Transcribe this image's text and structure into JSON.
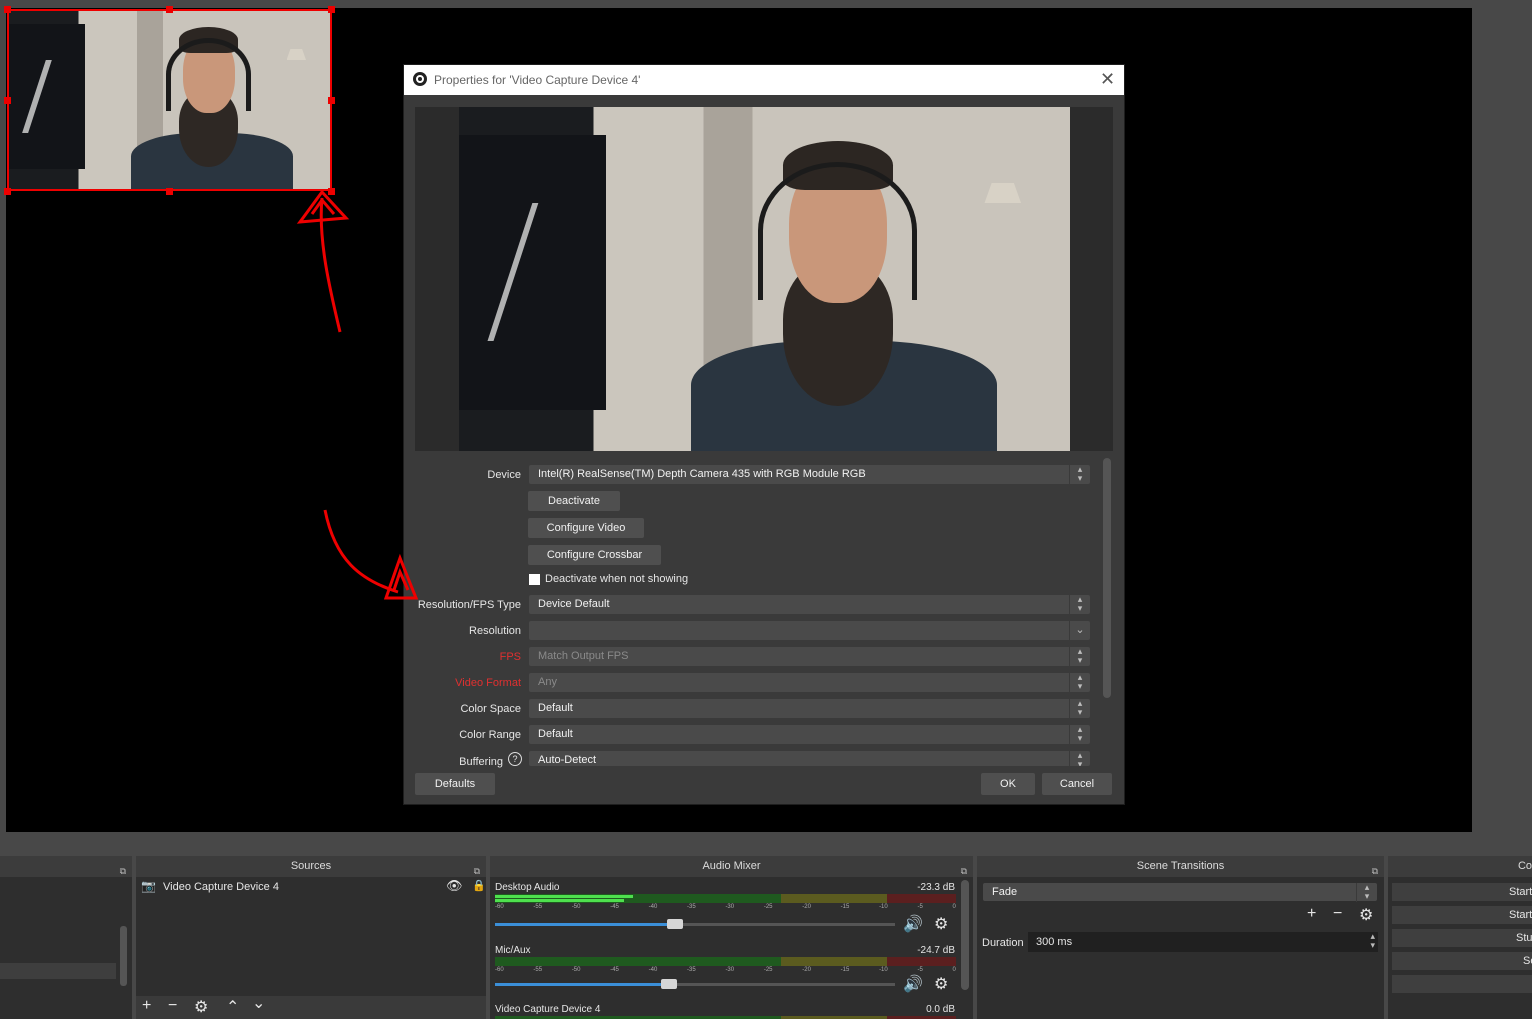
{
  "dialog": {
    "title": "Properties for 'Video Capture Device 4'",
    "close": "✕",
    "properties": {
      "device": {
        "label": "Device",
        "value": "Intel(R) RealSense(TM) Depth Camera 435 with RGB Module RGB"
      },
      "deactivate": "Deactivate",
      "configure_video": "Configure Video",
      "configure_crossbar": "Configure Crossbar",
      "deactivate_when_not_showing": "Deactivate when not showing",
      "res_fps_type": {
        "label": "Resolution/FPS Type",
        "value": "Device Default"
      },
      "resolution": {
        "label": "Resolution",
        "value": ""
      },
      "fps": {
        "label": "FPS",
        "value": "Match Output FPS"
      },
      "video_format": {
        "label": "Video Format",
        "value": "Any"
      },
      "color_space": {
        "label": "Color Space",
        "value": "Default"
      },
      "color_range": {
        "label": "Color Range",
        "value": "Default"
      },
      "buffering": {
        "label": "Buffering",
        "value": "Auto-Detect"
      }
    },
    "buttons": {
      "defaults": "Defaults",
      "ok": "OK",
      "cancel": "Cancel"
    }
  },
  "docks": {
    "sources": {
      "title": "Sources",
      "items": [
        {
          "name": "Video Capture Device 4"
        }
      ]
    },
    "audio_mixer": {
      "title": "Audio Mixer",
      "ticks": [
        "-60",
        "-55",
        "-50",
        "-45",
        "-40",
        "-35",
        "-30",
        "-25",
        "-20",
        "-15",
        "-10",
        "-5",
        "0"
      ],
      "channels": [
        {
          "name": "Desktop Audio",
          "db": "-23.3 dB",
          "level": 0.3,
          "volume": 0.45
        },
        {
          "name": "Mic/Aux",
          "db": "-24.7 dB",
          "level": 0.28,
          "volume": 0.43
        },
        {
          "name": "Video Capture Device 4",
          "db": "0.0 dB"
        }
      ]
    },
    "scene_transitions": {
      "title": "Scene Transitions",
      "transition": "Fade",
      "duration_label": "Duration",
      "duration_value": "300 ms"
    },
    "controls": {
      "title": "Co",
      "buttons": [
        "Start",
        "Start",
        "Stu",
        "Se"
      ]
    }
  },
  "colors": {
    "accent": "#3b8fd8",
    "annotation": "#e00000"
  }
}
